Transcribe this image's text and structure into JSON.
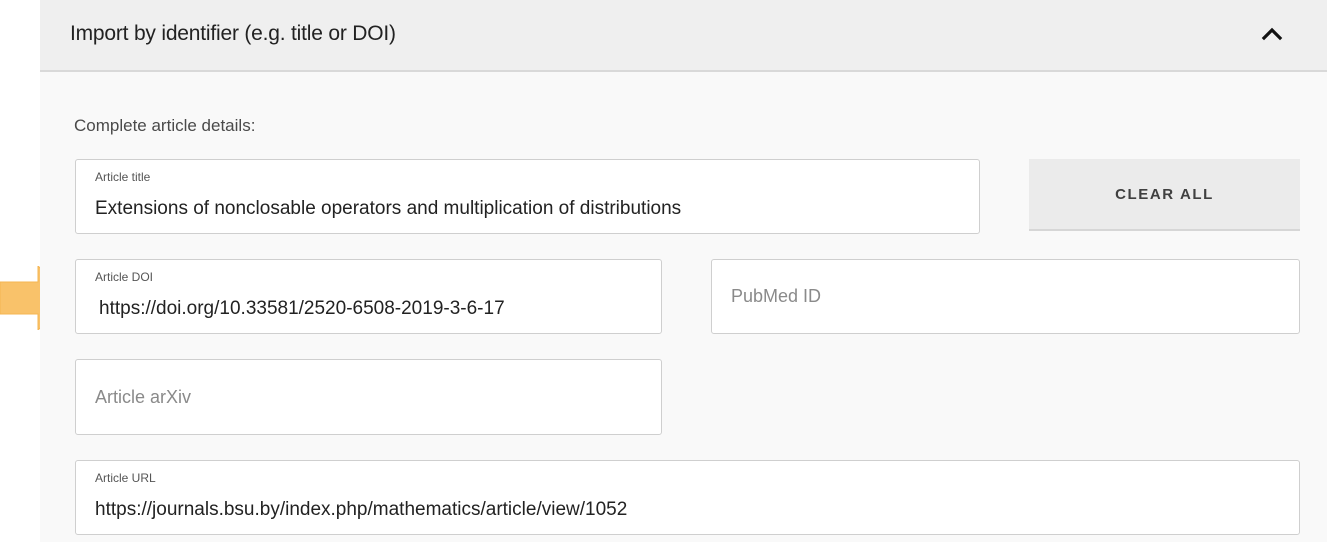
{
  "section": {
    "title": "Import by identifier (e.g. title or DOI)",
    "collapse_icon": "chevron-up-icon"
  },
  "form": {
    "instructions": "Complete article details:",
    "article_title": {
      "label": "Article title",
      "value": "Extensions of nonclosable operators and multiplication of distributions"
    },
    "article_doi": {
      "label": "Article DOI",
      "value": "https://doi.org/10.33581/2520-6508-2019-3-6-17"
    },
    "pubmed_id": {
      "placeholder": "PubMed ID"
    },
    "article_arxiv": {
      "placeholder": "Article arXiv"
    },
    "article_url": {
      "label": "Article URL",
      "value": "https://journals.bsu.by/index.php/mathematics/article/view/1052"
    },
    "clear_all_label": "CLEAR ALL"
  },
  "annotation": {
    "arrow_icon": "right-arrow-icon",
    "arrow_color": "#f9c26a"
  },
  "colors": {
    "header_bg": "#efefef",
    "panel_bg": "#f9f9f9",
    "button_bg": "#ebebeb"
  }
}
